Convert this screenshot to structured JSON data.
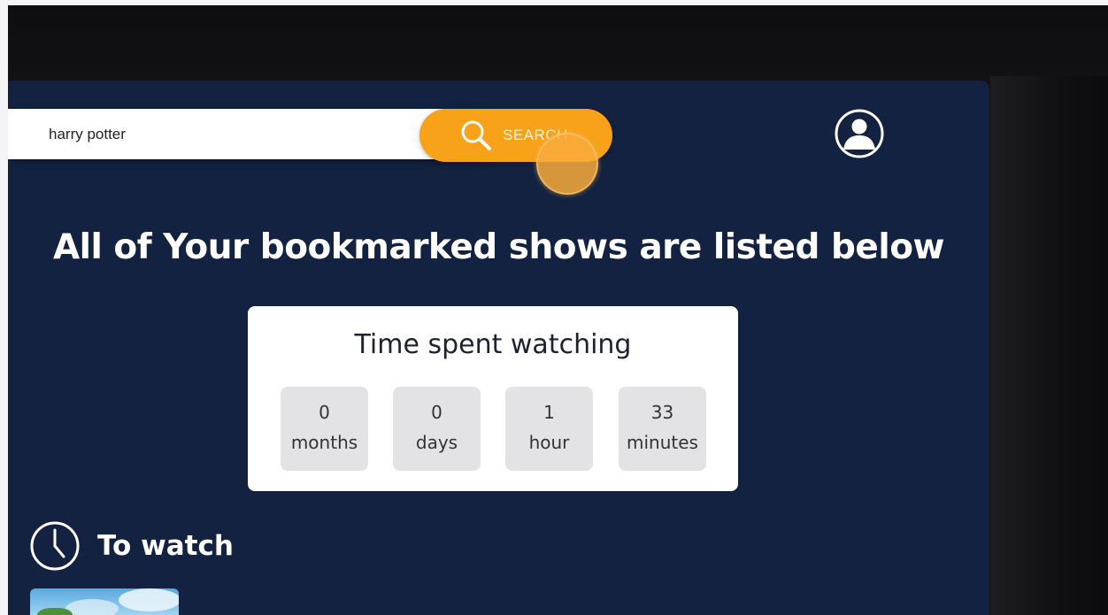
{
  "search": {
    "value": "harry potter",
    "button_label": "SEARCH"
  },
  "main": {
    "headline": "All of Your bookmarked shows are listed below",
    "time_card": {
      "title": "Time spent watching",
      "stats": [
        {
          "value": "0",
          "unit": "months"
        },
        {
          "value": "0",
          "unit": "days"
        },
        {
          "value": "1",
          "unit": "hour"
        },
        {
          "value": "33",
          "unit": "minutes"
        }
      ]
    },
    "section": {
      "title": "To watch"
    }
  },
  "icons": {
    "search": "search-icon",
    "avatar": "user-avatar-icon",
    "clock": "clock-icon"
  },
  "colors": {
    "panel": "#132241",
    "accent": "#f8a21a",
    "card": "#ffffff",
    "stat_box": "#e3e3e6"
  }
}
